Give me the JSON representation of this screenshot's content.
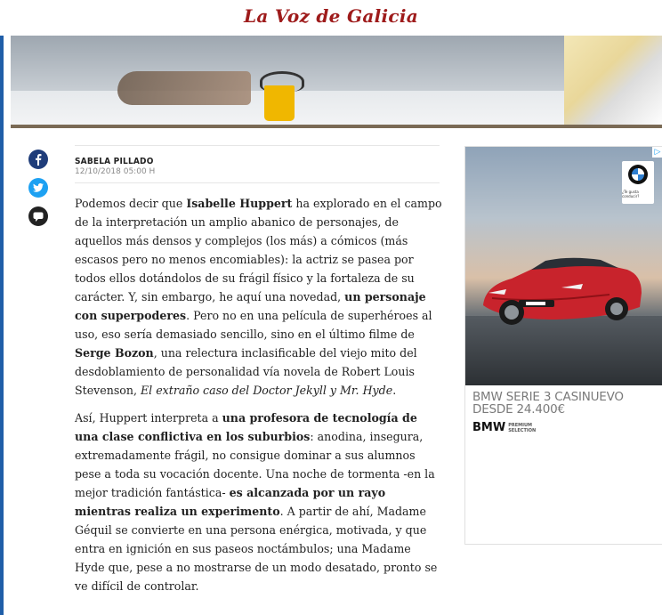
{
  "masthead": {
    "title": "La Voz de Galicia"
  },
  "article": {
    "author": "SABELA PILLADO",
    "date": "12/10/2018 05:00 H",
    "p1": {
      "t1": "Podemos decir que ",
      "b1": "Isabelle Huppert",
      "t2": " ha explorado en el campo de la interpretación un amplio abanico de personajes, de aquellos más densos y complejos (los más) a cómicos (más escasos pero no menos encomiables): la actriz se pasea por todos ellos dotándolos de su frágil físico y la fortaleza de su carácter. Y, sin embargo, he aquí una novedad, ",
      "b2": "un personaje con superpoderes",
      "t3": ". Pero no en una película de superhéroes al uso, eso sería demasiado sencillo, sino en el último filme de ",
      "b3": "Serge Bozon",
      "t4": ", una relectura inclasificable del viejo mito del desdoblamiento de personalidad vía novela de Robert Louis Stevenson, ",
      "i1": "El extraño caso del Doctor Jekyll y Mr. Hyde",
      "t5": "."
    },
    "p2": {
      "t1": "Así, Huppert interpreta a ",
      "b1": "una profesora de tecnología de una clase conflictiva en los suburbios",
      "t2": ": anodina, insegura, extremadamente frágil, no consigue dominar a sus alumnos pese a toda su vocación docente. Una noche de tormenta -en la mejor tradición fantástica- ",
      "b2": "es alcanzada por un rayo mientras realiza un experimento",
      "t3": ". A partir de ahí, Madame Géquil se convierte en una persona enérgica, motivada, y que entra en ignición en sus paseos noctámbulos; una Madame Hyde que, pese a no mostrarse de un modo desatado, pronto se ve difícil de controlar."
    }
  },
  "social": [
    "facebook-icon",
    "twitter-icon",
    "comment-icon"
  ],
  "ad": {
    "headline": "BMW SERIE 3 CASINUEVO DESDE 24.400€",
    "brand": "BMW",
    "brand_sub1": "PREMIUM",
    "brand_sub2": "SELECTION",
    "logo_text": "¿Te gusta conducir?",
    "badge": "▷"
  },
  "colors": {
    "masthead": "#9e1b1b",
    "facebook": "#1f3d7a",
    "twitter": "#1da1f2"
  }
}
